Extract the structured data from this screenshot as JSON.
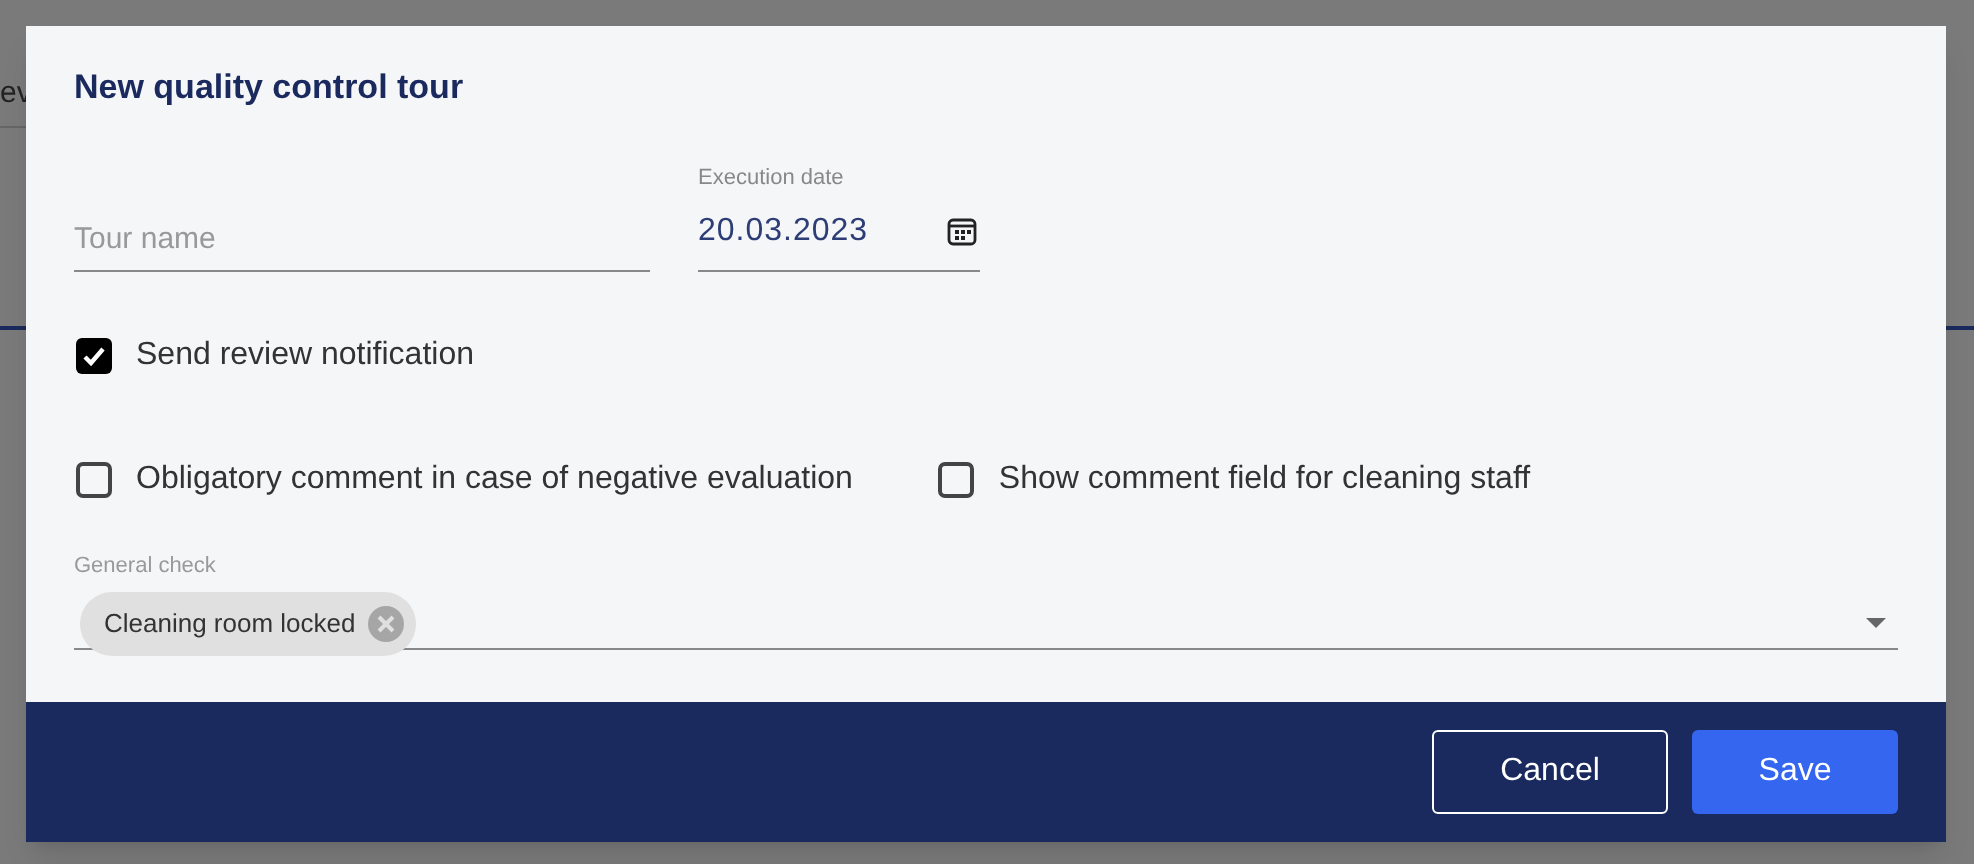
{
  "background": {
    "text": "ev"
  },
  "dialog": {
    "title": "New quality control tour",
    "tour_name": {
      "placeholder": "Tour name"
    },
    "execution_date": {
      "label": "Execution date",
      "value": "20.03.2023"
    },
    "options": [
      {
        "label": "Send review notification",
        "checked": true
      },
      {
        "label": "Obligatory comment in case of negative evaluation",
        "checked": false
      },
      {
        "label": "Show comment field for cleaning staff",
        "checked": false
      }
    ],
    "general_check": {
      "label": "General check",
      "chips": [
        "Cleaning room locked"
      ]
    },
    "buttons": [
      {
        "label": "Cancel",
        "kind": "secondary"
      },
      {
        "label": "Save",
        "kind": "primary"
      }
    ]
  }
}
